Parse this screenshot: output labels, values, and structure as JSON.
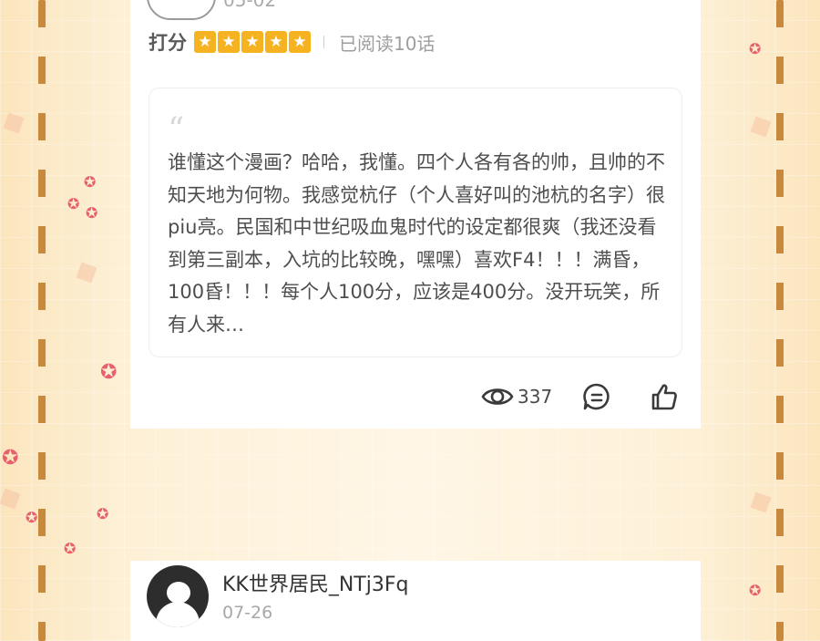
{
  "review_card": {
    "date_partial": "05-02",
    "rating_label": "打分",
    "star_count": 5,
    "read_info": "已阅读10话",
    "quote_mark": "“",
    "review_text": "谁懂这个漫画？哈哈，我懂。四个人各有各的帅，且帅的不知天地为何物。我感觉杭仔（个人喜好叫的池杭的名字）很piu亮。民国和中世纪吸血鬼时代的设定都很爽（我还没看到第三副本，入坑的比较晚，嘿嘿）喜欢F4！！！满昏，100昏！！！每个人100分，应该是400分。没开玩笑，所有人来…",
    "views": "337"
  },
  "next_card": {
    "username": "KK世界居民_NTj3Fq",
    "date": "07-26"
  },
  "colors": {
    "star": "#f6b321",
    "background": "#fbe8c3",
    "dash": "#c8893d"
  },
  "icons": [
    "eye-icon",
    "comment-icon",
    "thumbs-up-icon",
    "star-icon",
    "avatar-icon"
  ]
}
